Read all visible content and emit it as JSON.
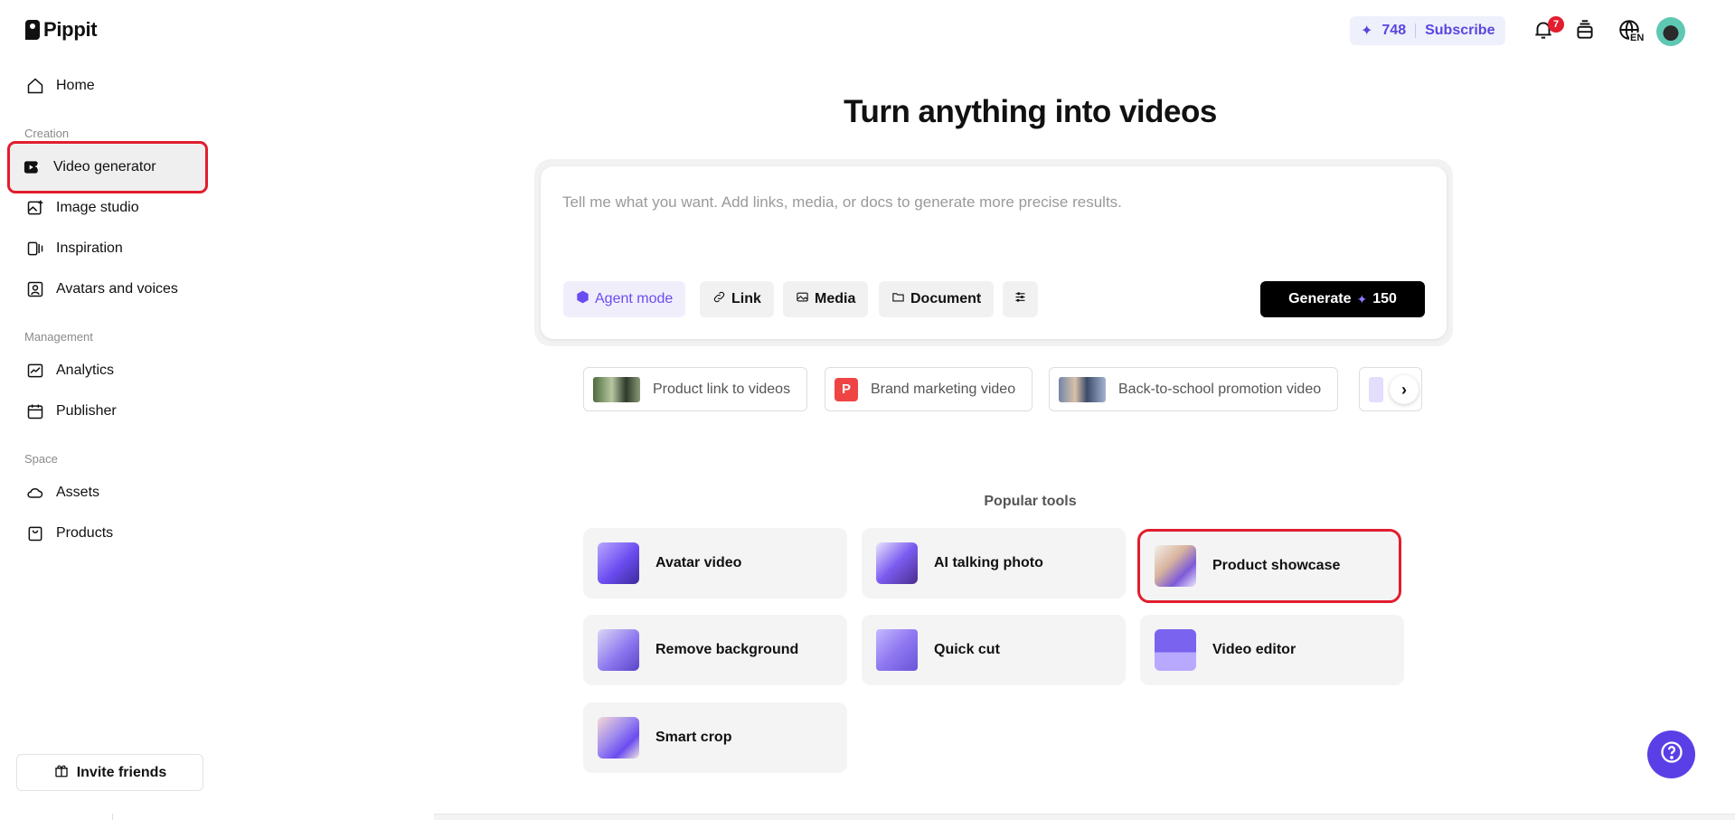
{
  "brand": {
    "name": "Pippit"
  },
  "sidebar": {
    "home": "Home",
    "sections": {
      "creation": "Creation",
      "management": "Management",
      "space": "Space"
    },
    "items": [
      {
        "label": "Video generator",
        "icon": "video-plus-icon"
      },
      {
        "label": "Image studio",
        "icon": "image-plus-icon"
      },
      {
        "label": "Inspiration",
        "icon": "inspiration-icon"
      },
      {
        "label": "Avatars and voices",
        "icon": "avatar-icon"
      },
      {
        "label": "Analytics",
        "icon": "analytics-icon"
      },
      {
        "label": "Publisher",
        "icon": "calendar-icon"
      },
      {
        "label": "Assets",
        "icon": "cloud-icon"
      },
      {
        "label": "Products",
        "icon": "bag-icon"
      }
    ],
    "invite": "Invite friends"
  },
  "topbar": {
    "credits": "748",
    "subscribe": "Subscribe",
    "notifications_count": "7",
    "language_label": "EN"
  },
  "main": {
    "title": "Turn anything into videos",
    "prompt_placeholder": "Tell me what you want. Add links, media, or docs to generate more precise results.",
    "chips": {
      "agent": "Agent mode",
      "link": "Link",
      "media": "Media",
      "document": "Document"
    },
    "generate": {
      "label": "Generate",
      "cost": "150"
    },
    "suggestions": [
      "Product link to videos",
      "Brand marketing video",
      "Back-to-school promotion video"
    ],
    "suggestion_brand_letter": "P",
    "popular_tools_title": "Popular tools",
    "tools": [
      "Avatar video",
      "AI talking photo",
      "Product showcase",
      "Remove background",
      "Quick cut",
      "Video editor",
      "Smart crop"
    ]
  },
  "colors": {
    "accent": "#6a4cf0",
    "highlight": "#e11d2e",
    "help_button": "#5b3fe6"
  }
}
